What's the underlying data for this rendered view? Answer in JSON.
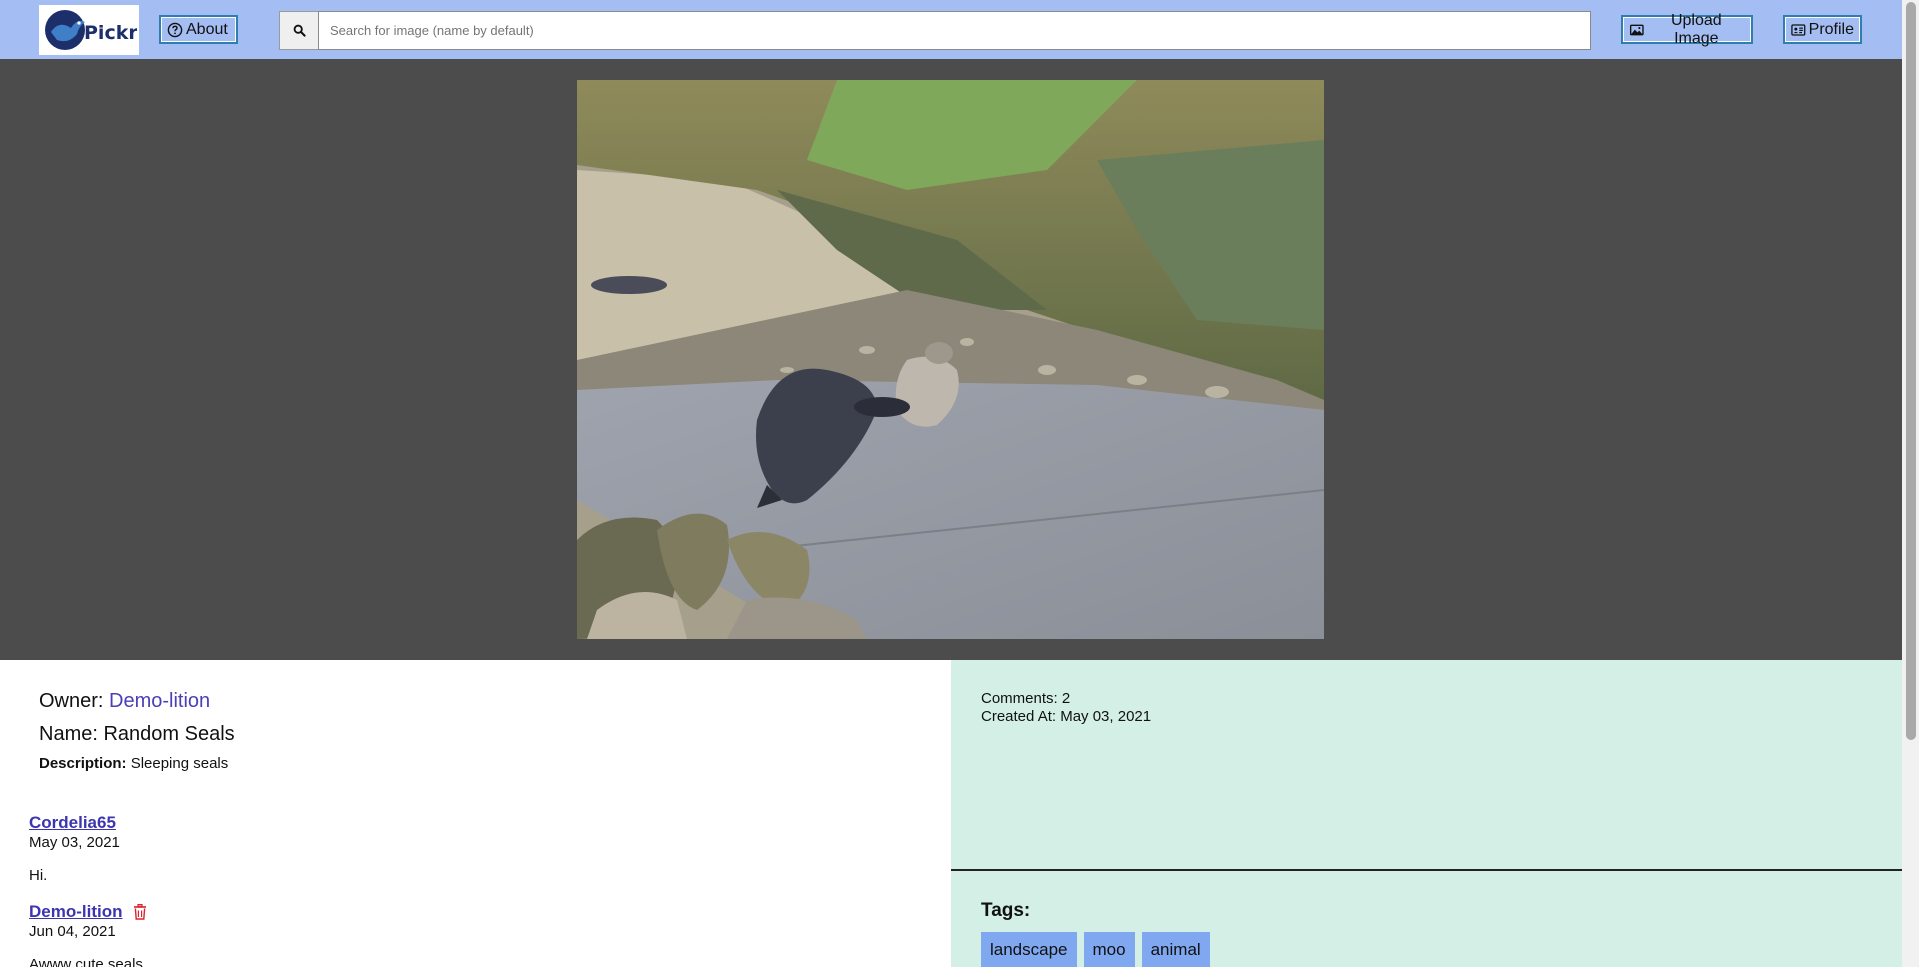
{
  "header": {
    "logo_text": "Pickr",
    "about_label": "About",
    "search_placeholder": "Search for image (name by default)",
    "search_value": "",
    "upload_label": "Upload Image",
    "profile_label": "Profile",
    "icons": {
      "about": "question-circle-icon",
      "search": "magnifier-icon",
      "upload": "image-icon",
      "profile": "id-card-icon"
    }
  },
  "image": {
    "alt": "Random Seals"
  },
  "details": {
    "owner_label": "Owner:",
    "owner_name": "Demo-lition",
    "name_label": "Name:",
    "name_value": "Random Seals",
    "description_label": "Description:",
    "description_value": "Sleeping seals"
  },
  "comments": [
    {
      "user": "Cordelia65",
      "date": "May 03, 2021",
      "text": "Hi.",
      "deletable": false
    },
    {
      "user": "Demo-lition",
      "date": "Jun 04, 2021",
      "text": "Awww cute seals",
      "deletable": true
    }
  ],
  "meta": {
    "comments_text": "Comments: 2",
    "created_text": "Created At: May 03, 2021"
  },
  "tags": {
    "title": "Tags:",
    "items": [
      "landscape",
      "moo",
      "animal"
    ]
  },
  "colors": {
    "header_bg": "#a4bdf2",
    "stage_bg": "#4c4c4c",
    "panel_bg": "#d3efe6",
    "link": "#3d35b0",
    "tag_bg": "#7fa8f0",
    "delete": "#e0202a"
  }
}
